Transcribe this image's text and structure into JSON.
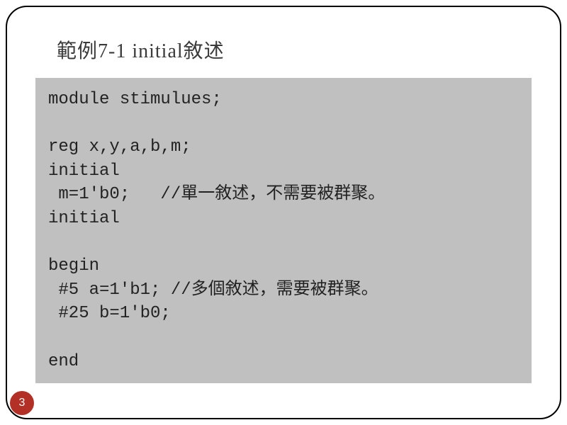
{
  "slide": {
    "title": "範例7-1  initial敘述",
    "page_number": "3",
    "code_lines": [
      "module stimulues;",
      "",
      "reg x,y,a,b,m;",
      "initial",
      " m=1'b0;   //單一敘述，不需要被群聚。",
      "initial",
      "",
      "begin",
      " #5 a=1'b1; //多個敘述，需要被群聚。",
      " #25 b=1'b0;",
      "",
      "end"
    ]
  }
}
